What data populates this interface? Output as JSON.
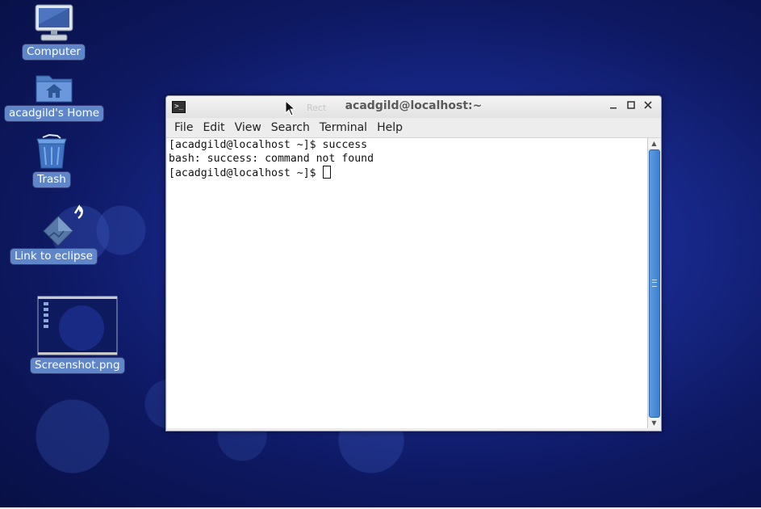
{
  "desktop": {
    "icons": [
      {
        "label": "Computer",
        "icon": "computer-icon"
      },
      {
        "label": "acadgild's Home",
        "icon": "home-folder-icon"
      },
      {
        "label": "Trash",
        "icon": "trash-icon"
      },
      {
        "label": "Link to eclipse",
        "icon": "eclipse-launcher-icon"
      },
      {
        "label": "Screenshot.png",
        "icon": "image-thumbnail-icon"
      }
    ]
  },
  "terminal": {
    "title": "acadgild@localhost:~",
    "ghost_text": "Rect",
    "app_icon": "terminal-icon",
    "menu": [
      "File",
      "Edit",
      "View",
      "Search",
      "Terminal",
      "Help"
    ],
    "lines": [
      "[acadgild@localhost ~]$ success",
      "bash: success: command not found",
      "[acadgild@localhost ~]$ "
    ],
    "buttons": {
      "minimize_icon": "minimize-icon",
      "maximize_icon": "maximize-icon",
      "close_icon": "close-icon"
    }
  },
  "colors": {
    "desktop_bg": "#18288a",
    "icon_label_bg": "#5f86c9",
    "scroll_thumb": "#3c7fd1"
  }
}
